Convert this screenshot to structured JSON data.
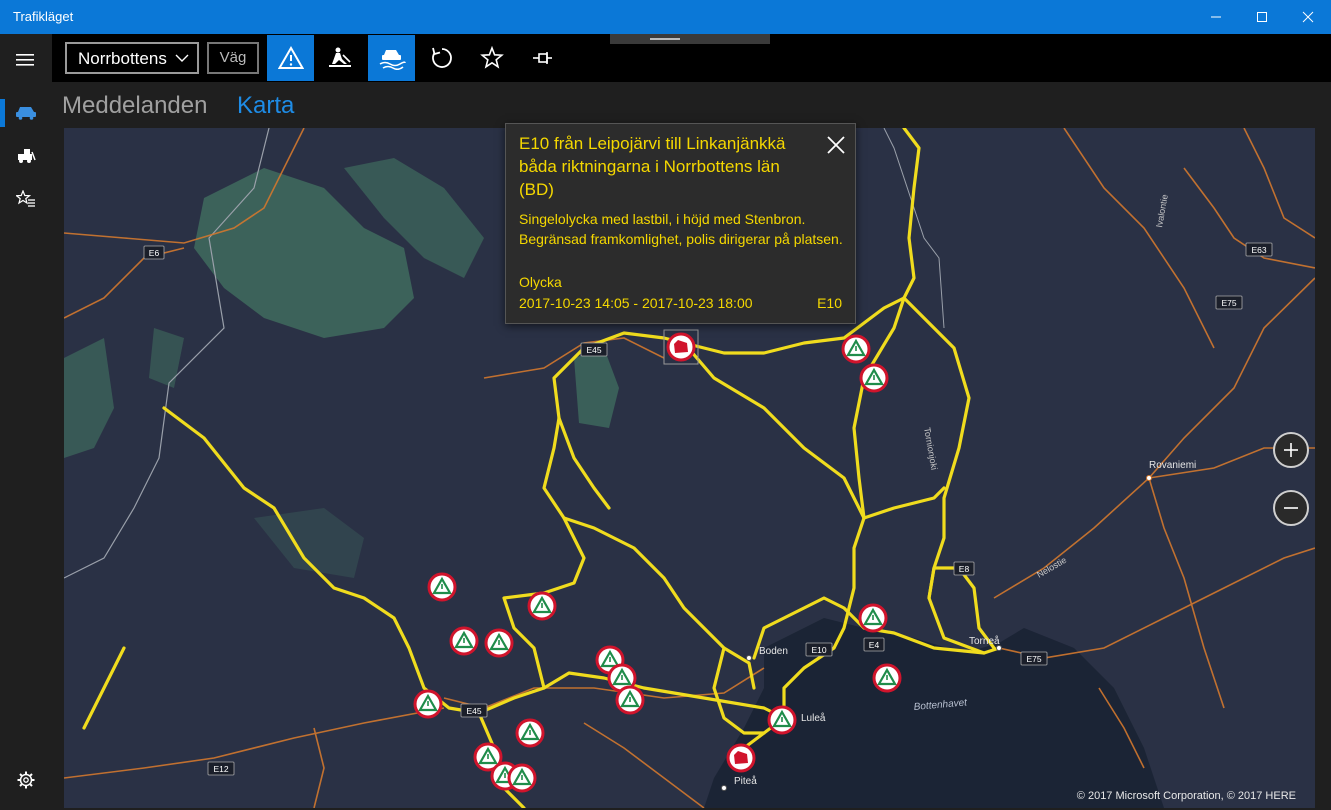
{
  "window": {
    "title": "Trafikläget"
  },
  "toolbar": {
    "region_select": "Norrbottens",
    "road_button": "Väg"
  },
  "pivot": {
    "tabs": [
      "Meddelanden",
      "Karta"
    ],
    "active": "Karta"
  },
  "popup": {
    "title": "E10 från Leipojärvi till Linkanjänkkä båda riktningarna i Norrbottens län (BD)",
    "description": "Singelolycka med lastbil, i höjd med Stenbron. Begränsad framkomlighet, polis dirigerar på platsen.",
    "type": "Olycka",
    "time": "2017-10-23 14:05 - 2017-10-23 18:00",
    "road": "E10"
  },
  "map": {
    "road_labels": [
      "E6",
      "E45",
      "E63",
      "E75",
      "E8",
      "E10",
      "E4",
      "E75",
      "E45",
      "E12"
    ],
    "place_labels": [
      "Rovaniemi",
      "Boden",
      "Luleå",
      "Piteå",
      "Torneå"
    ],
    "river_labels": [
      "Ivalontie",
      "Tornionjoki",
      "Nelostie"
    ],
    "water_labels": [
      "Bottenhavet"
    ],
    "copyright": "© 2017 Microsoft Corporation, © 2017 HERE"
  },
  "colors": {
    "accent": "#0b78d7",
    "road_highlight": "#f0dc1e",
    "popup_text": "#f5d800",
    "map_bg": "#2a3145",
    "sea": "#1b2435",
    "forest": "#3f6b5e"
  }
}
